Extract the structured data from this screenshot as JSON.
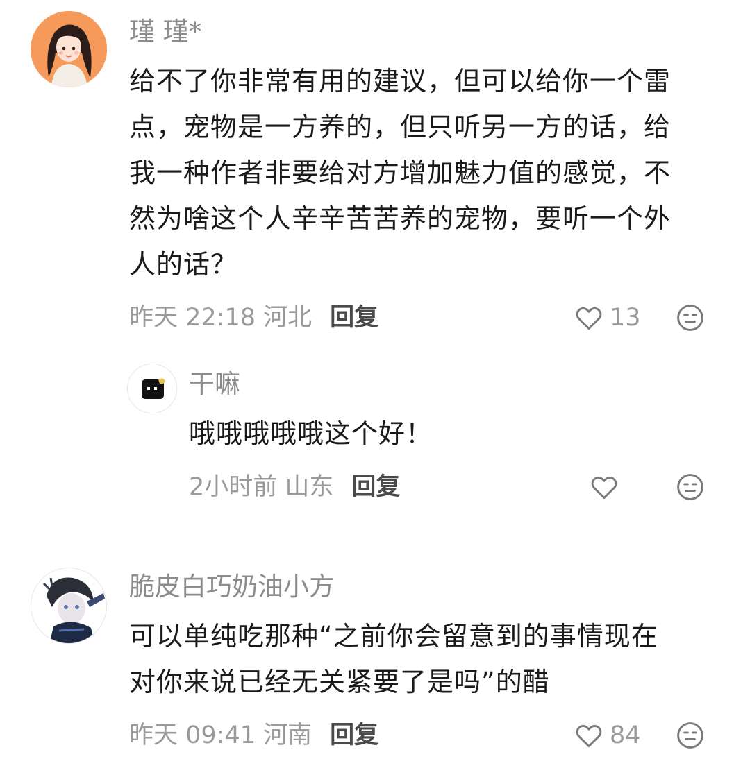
{
  "comments": [
    {
      "name": "瑾 瑾*",
      "lines": [
        "给不了你非常有用的建议，但可以给你一个雷",
        "点，宠物是一方养的，但只听另一方的话，给",
        "我一种作者非要给对方增加魅力值的感觉，不",
        "然为啥这个人辛辛苦苦养的宠物，要听一个外",
        "人的话？"
      ],
      "meta": "昨天 22:18 河北",
      "reply_label": "回复",
      "likes": "13",
      "accent": "#f5a26a"
    },
    {
      "name": "干嘛",
      "lines": [
        "哦哦哦哦哦这个好！"
      ],
      "meta": "2小时前 山东",
      "reply_label": "回复",
      "likes": ""
    },
    {
      "name": "脆皮白巧奶油小方",
      "lines": [
        "可以单纯吃那种“之前你会留意到的事情现在",
        "对你来说已经无关紧要了是吗”的醋"
      ],
      "meta": "昨天 09:41 河南",
      "reply_label": "回复",
      "likes": "84"
    }
  ],
  "icons": {
    "like": "heart-outline-icon",
    "dislike": "meh-face-icon"
  }
}
